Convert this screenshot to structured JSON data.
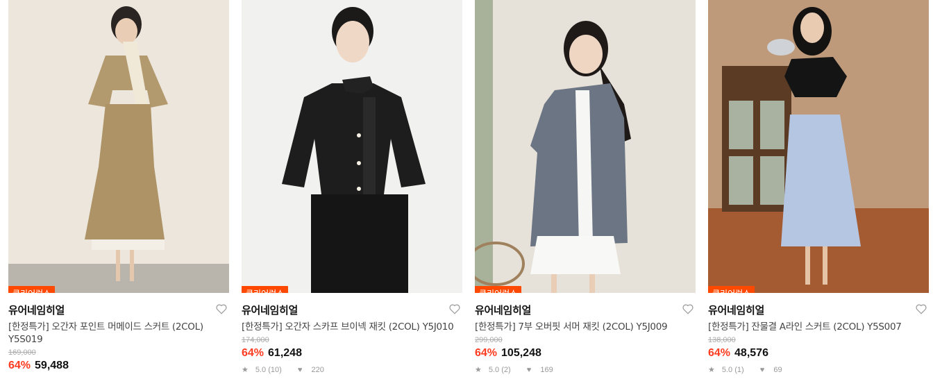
{
  "products": [
    {
      "badge": "클리어런스",
      "brand": "유어네임히얼",
      "title": "[한정특가] 오간자 포인트 머메이드 스커트 (2COL) Y5S019",
      "original_price": "169,000",
      "discount": "64%",
      "price": "59,488",
      "rating": "",
      "likes": ""
    },
    {
      "badge": "클리어런스",
      "brand": "유어네임히얼",
      "title": "[한정특가] 오간자 스카프 브이넥 재킷 (2COL) Y5J010",
      "original_price": "174,000",
      "discount": "64%",
      "price": "61,248",
      "rating": "5.0 (10)",
      "likes": "220"
    },
    {
      "badge": "클리어런스",
      "brand": "유어네임히얼",
      "title": "[한정특가] 7부 오버핏 서머 재킷 (2COL) Y5J009",
      "original_price": "299,000",
      "discount": "64%",
      "price": "105,248",
      "rating": "5.0 (2)",
      "likes": "169"
    },
    {
      "badge": "클리어런스",
      "brand": "유어네임히얼",
      "title": "[한정특가] 잔물결 A라인 스커트 (2COL) Y5S007",
      "original_price": "138,000",
      "discount": "64%",
      "price": "48,576",
      "rating": "5.0 (1)",
      "likes": "69"
    }
  ],
  "colors": {
    "accent": "#ff4800",
    "discount": "#ff3b1f"
  }
}
